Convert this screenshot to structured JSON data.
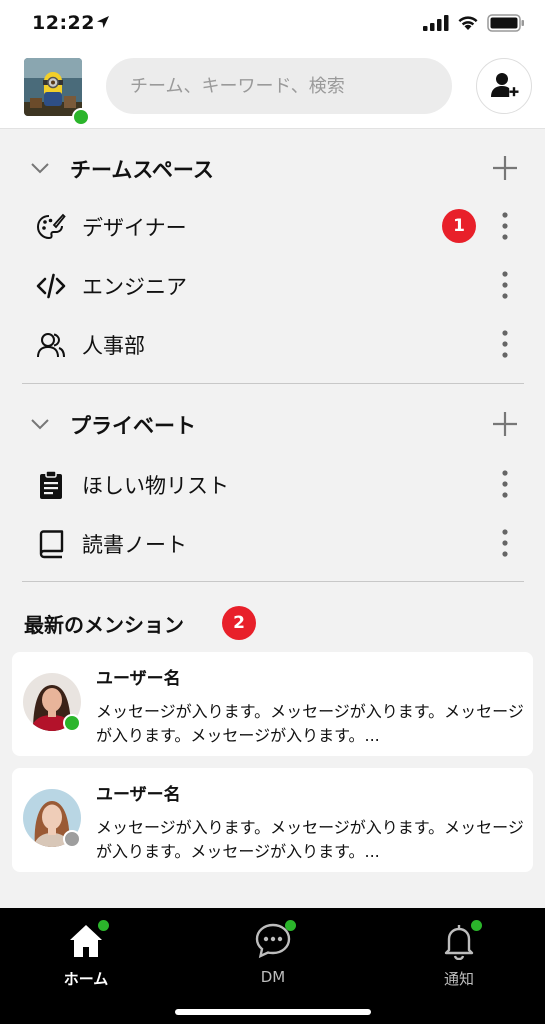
{
  "status_bar": {
    "time": "12:22"
  },
  "search": {
    "placeholder": "チーム、キーワード、検索"
  },
  "team_space": {
    "title": "チームスペース",
    "items": [
      {
        "label": "デザイナー",
        "badge": "1"
      },
      {
        "label": "エンジニア"
      },
      {
        "label": "人事部"
      }
    ]
  },
  "private": {
    "title": "プライベート",
    "items": [
      {
        "label": "ほしい物リスト"
      },
      {
        "label": "読書ノート"
      }
    ]
  },
  "mentions": {
    "title": "最新のメンション",
    "badge": "2",
    "cards": [
      {
        "user": "ユーザー名",
        "message": "メッセージが入ります。メッセージが入ります。メッセージが入ります。メッセージが入ります。...",
        "status": "online"
      },
      {
        "user": "ユーザー名",
        "message": "メッセージが入ります。メッセージが入ります。メッセージが入ります。メッセージが入ります。...",
        "status": "offline"
      }
    ]
  },
  "tabbar": {
    "tabs": [
      {
        "label": "ホーム",
        "icon": "home-icon",
        "active": true
      },
      {
        "label": "DM",
        "icon": "chat-bubble-icon",
        "active": false
      },
      {
        "label": "通知",
        "icon": "bell-icon",
        "active": false
      }
    ]
  },
  "colors": {
    "badge": "#e8202a",
    "online": "#2bb52b",
    "offline": "#9e9e9e",
    "tabbar_bg": "#000000"
  }
}
